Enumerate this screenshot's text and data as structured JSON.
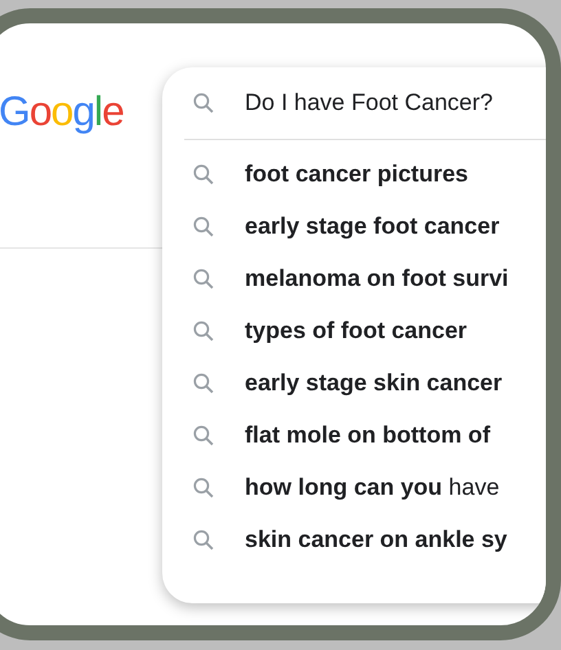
{
  "logo": "Google",
  "search": {
    "value": "Do I have Foot Cancer?"
  },
  "suggestions": [
    {
      "text": "foot cancer pictures",
      "bold": true
    },
    {
      "text": "early stage foot cancer",
      "bold": true
    },
    {
      "text": "melanoma on foot survi",
      "bold": true
    },
    {
      "text": "types of foot cancer",
      "bold": true
    },
    {
      "text": "early stage skin cancer",
      "bold": true
    },
    {
      "text": "flat mole on bottom of",
      "bold": true
    },
    {
      "text": "**how long can you** have",
      "bold": false
    },
    {
      "text": "skin cancer on ankle sy",
      "bold": true
    }
  ]
}
